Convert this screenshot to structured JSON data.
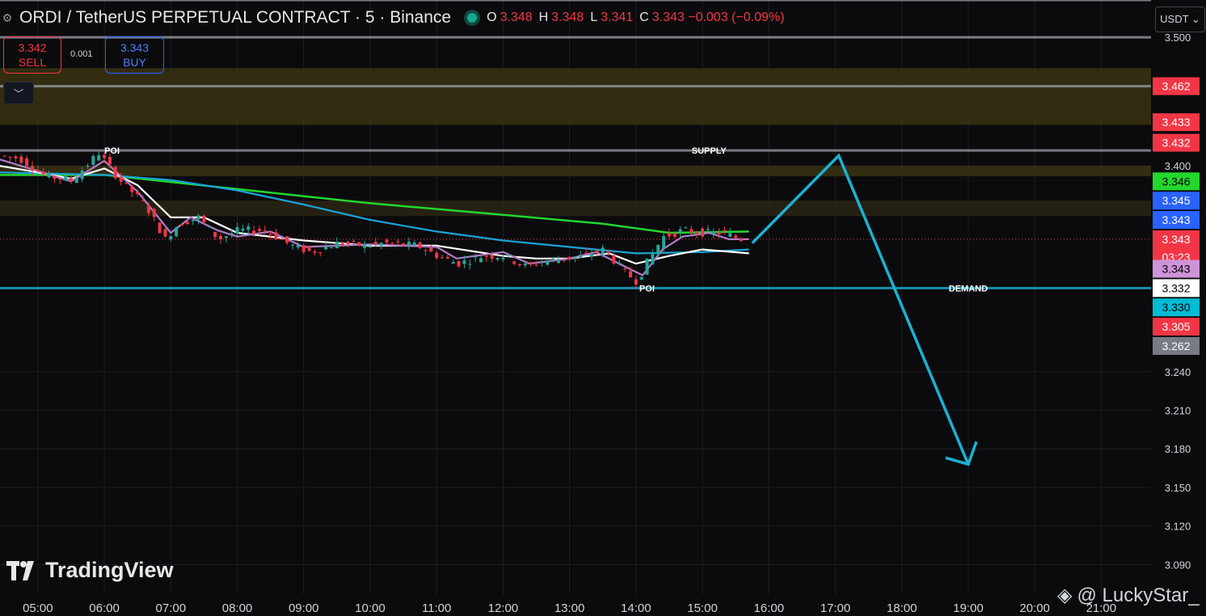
{
  "header": {
    "title": "ORDI / TetherUS PERPETUAL CONTRACT · 5 · Binance",
    "ohlc": [
      {
        "k": "O",
        "v": "3.348"
      },
      {
        "k": "H",
        "v": "3.348"
      },
      {
        "k": "L",
        "v": "3.341"
      },
      {
        "k": "C",
        "v": "3.343 −0.003 (−0.09%)"
      }
    ]
  },
  "trade": {
    "sell_price": "3.342",
    "sell_label": "SELL",
    "buy_price": "3.343",
    "buy_label": "BUY",
    "spread": "0.001"
  },
  "currency_label": "USDT ⌄",
  "branding": {
    "logo_text": "TradingView",
    "watermark": "@ LuckyStar_"
  },
  "colors": {
    "bg": "#0b0b0d",
    "up": "#26a69a",
    "down": "#f23645",
    "green_ma": "#22d72d",
    "blue_ma": "#1ba3d6",
    "white_ma": "#ffffff",
    "purple_ma": "#b07cc6",
    "arrow": "#1ab2d2",
    "zone": "#3a3413",
    "level": "#9598a1"
  },
  "chart_data": {
    "type": "candlestick",
    "symbol": "ORDI / TetherUS PERPETUAL CONTRACT",
    "interval": "5",
    "exchange": "Binance",
    "ylim": [
      3.067,
      3.529
    ],
    "y_ticks": [
      3.5,
      3.4,
      3.24,
      3.21,
      3.18,
      3.15,
      3.12,
      3.09
    ],
    "x_ticks": [
      "05:00",
      "06:00",
      "07:00",
      "08:00",
      "09:00",
      "10:00",
      "11:00",
      "12:00",
      "13:00",
      "14:00",
      "15:00",
      "16:00",
      "17:00",
      "18:00",
      "19:00",
      "20:00",
      "21:00"
    ],
    "x_range_hours": [
      4.43,
      21.75
    ],
    "price_series": [
      [
        4.5,
        3.408
      ],
      [
        4.8,
        3.406
      ],
      [
        5.2,
        3.392
      ],
      [
        5.6,
        3.389
      ],
      [
        6.0,
        3.41
      ],
      [
        6.3,
        3.39
      ],
      [
        6.7,
        3.37
      ],
      [
        7.0,
        3.343
      ],
      [
        7.2,
        3.355
      ],
      [
        7.5,
        3.36
      ],
      [
        7.8,
        3.343
      ],
      [
        8.1,
        3.35
      ],
      [
        8.5,
        3.35
      ],
      [
        8.9,
        3.338
      ],
      [
        9.2,
        3.333
      ],
      [
        9.6,
        3.34
      ],
      [
        10.0,
        3.338
      ],
      [
        10.3,
        3.34
      ],
      [
        10.8,
        3.338
      ],
      [
        11.1,
        3.33
      ],
      [
        11.4,
        3.324
      ],
      [
        11.8,
        3.33
      ],
      [
        12.1,
        3.33
      ],
      [
        12.4,
        3.322
      ],
      [
        12.7,
        3.326
      ],
      [
        13.0,
        3.328
      ],
      [
        13.3,
        3.33
      ],
      [
        13.6,
        3.335
      ],
      [
        13.9,
        3.318
      ],
      [
        14.1,
        3.31
      ],
      [
        14.3,
        3.33
      ],
      [
        14.5,
        3.345
      ],
      [
        14.8,
        3.35
      ],
      [
        15.1,
        3.348
      ],
      [
        15.4,
        3.348
      ],
      [
        15.65,
        3.343
      ]
    ],
    "moving_averages": [
      {
        "color": "#22d72d",
        "points": [
          [
            4.43,
            3.393
          ],
          [
            6.0,
            3.393
          ],
          [
            8.0,
            3.382
          ],
          [
            10.0,
            3.371
          ],
          [
            12.0,
            3.362
          ],
          [
            13.5,
            3.355
          ],
          [
            14.5,
            3.348
          ],
          [
            15.7,
            3.349
          ]
        ]
      },
      {
        "color": "#1ba3d6",
        "points": [
          [
            4.43,
            3.395
          ],
          [
            6.0,
            3.393
          ],
          [
            7.0,
            3.389
          ],
          [
            8.0,
            3.381
          ],
          [
            9.0,
            3.37
          ],
          [
            10.0,
            3.358
          ],
          [
            11.0,
            3.349
          ],
          [
            12.0,
            3.342
          ],
          [
            13.0,
            3.337
          ],
          [
            14.0,
            3.332
          ],
          [
            15.0,
            3.333
          ],
          [
            15.7,
            3.335
          ]
        ]
      },
      {
        "color": "#ffffff",
        "points": [
          [
            4.43,
            3.4
          ],
          [
            5.0,
            3.395
          ],
          [
            5.5,
            3.39
          ],
          [
            6.0,
            3.398
          ],
          [
            6.5,
            3.385
          ],
          [
            7.0,
            3.36
          ],
          [
            7.5,
            3.36
          ],
          [
            8.0,
            3.348
          ],
          [
            9.0,
            3.342
          ],
          [
            10.0,
            3.338
          ],
          [
            11.0,
            3.338
          ],
          [
            12.0,
            3.33
          ],
          [
            12.5,
            3.328
          ],
          [
            13.0,
            3.328
          ],
          [
            13.6,
            3.332
          ],
          [
            14.0,
            3.324
          ],
          [
            14.5,
            3.33
          ],
          [
            15.0,
            3.335
          ],
          [
            15.7,
            3.332
          ]
        ]
      },
      {
        "color": "#b07cc6",
        "points": [
          [
            4.43,
            3.405
          ],
          [
            5.0,
            3.396
          ],
          [
            5.5,
            3.388
          ],
          [
            6.0,
            3.404
          ],
          [
            6.5,
            3.38
          ],
          [
            7.0,
            3.348
          ],
          [
            7.3,
            3.36
          ],
          [
            7.7,
            3.35
          ],
          [
            8.0,
            3.345
          ],
          [
            8.5,
            3.349
          ],
          [
            9.0,
            3.337
          ],
          [
            9.5,
            3.338
          ],
          [
            10.0,
            3.339
          ],
          [
            11.0,
            3.337
          ],
          [
            11.3,
            3.328
          ],
          [
            12.0,
            3.333
          ],
          [
            12.4,
            3.324
          ],
          [
            13.0,
            3.328
          ],
          [
            13.4,
            3.333
          ],
          [
            13.9,
            3.32
          ],
          [
            14.1,
            3.315
          ],
          [
            14.4,
            3.335
          ],
          [
            14.7,
            3.345
          ],
          [
            15.1,
            3.348
          ],
          [
            15.4,
            3.343
          ],
          [
            15.7,
            3.343
          ]
        ]
      }
    ],
    "horizontal_levels": [
      {
        "y": 3.529,
        "color": "#9598a1"
      },
      {
        "y": 3.5,
        "color": "#9598a1"
      },
      {
        "y": 3.462,
        "color": "#9598a1"
      },
      {
        "y": 3.412,
        "color": "#9598a1",
        "label": "SUPPLY",
        "label_x_hour": 15.1
      },
      {
        "y": 3.305,
        "color": "#1ab2d2",
        "label": "DEMAND",
        "label_x_hour": 19.0
      }
    ],
    "zones": [
      {
        "y1": 3.476,
        "y2": 3.432,
        "color": "#3a3413"
      },
      {
        "y1": 3.4,
        "y2": 3.392,
        "color": "#3a3413"
      },
      {
        "y1": 3.373,
        "y2": 3.361,
        "color": "#2a2614"
      }
    ],
    "poi_labels": [
      {
        "text": "POI",
        "x_hour": 6.0,
        "y": 3.412
      },
      {
        "text": "POI",
        "x_hour": 14.05,
        "y": 3.305
      }
    ],
    "projection": {
      "color": "#1ab2d2",
      "points": [
        [
          15.75,
          3.34
        ],
        [
          17.05,
          3.408
        ],
        [
          19.0,
          3.168
        ]
      ]
    },
    "price_tags": [
      {
        "text": "3.462",
        "y": 3.462,
        "bg": "#f23645",
        "fg": "#ffffff"
      },
      {
        "text": "3.433",
        "y": 3.434,
        "bg": "#f23645",
        "fg": "#ffffff"
      },
      {
        "text": "3.432",
        "y": 3.418,
        "bg": "#f23645",
        "fg": "#ffffff"
      },
      {
        "text": "3.346",
        "y": 3.388,
        "bg": "#22d72d",
        "fg": "#000000"
      },
      {
        "text": "3.345",
        "y": 3.373,
        "bg": "#2962ff",
        "fg": "#ffffff"
      },
      {
        "text": "3.343",
        "y": 3.358,
        "bg": "#2962ff",
        "fg": "#ffffff"
      },
      {
        "text": "3.343",
        "y": 3.343,
        "bg": "#f23645",
        "fg": "#ffffff",
        "sub": "03:23"
      },
      {
        "text": "3.343",
        "y": 3.32,
        "bg": "#ce93d8",
        "fg": "#000000"
      },
      {
        "text": "3.332",
        "y": 3.305,
        "bg": "#ffffff",
        "fg": "#000000"
      },
      {
        "text": "3.330",
        "y": 3.29,
        "bg": "#00bcd4",
        "fg": "#000000"
      },
      {
        "text": "3.305",
        "y": 3.275,
        "bg": "#f23645",
        "fg": "#ffffff"
      },
      {
        "text": "3.262",
        "y": 3.26,
        "bg": "#787b86",
        "fg": "#ffffff"
      }
    ]
  }
}
